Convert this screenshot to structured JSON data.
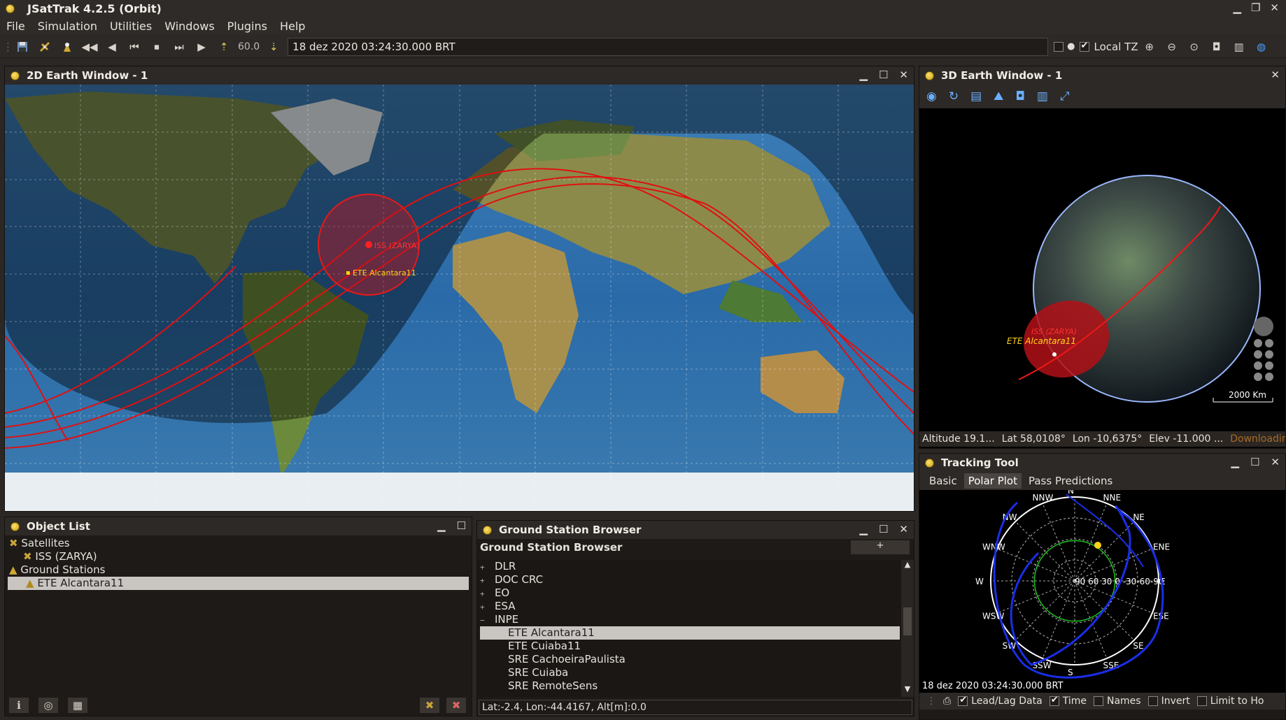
{
  "app": {
    "title": "JSatTrak 4.2.5 (Orbit)"
  },
  "menu": [
    "File",
    "Simulation",
    "Utilities",
    "Windows",
    "Plugins",
    "Help"
  ],
  "toolbar": {
    "step": "60.0",
    "datetime": "18 dez 2020 03:24:30.000 BRT",
    "local_tz_label": "Local TZ"
  },
  "earth2d": {
    "title": "2D Earth Window - 1",
    "sat_label": "ISS (ZARYA)",
    "gs_label": "ETE Alcantara11"
  },
  "earth3d": {
    "title": "3D Earth Window - 1",
    "sat_label": "ISS (ZARYA)",
    "gs_label": "ETE Alcantara11",
    "scale": "2000 Km",
    "status": {
      "altitude": "Altitude 19.1...",
      "lat": "Lat 58,0108°",
      "lon": "Lon -10,6375°",
      "elev": "Elev -11.000 ...",
      "download": "Downloading"
    }
  },
  "object_list": {
    "title": "Object List",
    "items": [
      {
        "label": "Satellites"
      },
      {
        "label": "ISS (ZARYA)"
      },
      {
        "label": "Ground Stations"
      },
      {
        "label": "ETE Alcantara11"
      }
    ]
  },
  "gsb": {
    "title": "Ground Station Browser",
    "heading": "Ground Station Browser",
    "add_label": "+",
    "items": [
      {
        "label": "DLR",
        "sign": "+"
      },
      {
        "label": "DOC CRC",
        "sign": "+"
      },
      {
        "label": "EO",
        "sign": "+"
      },
      {
        "label": "ESA",
        "sign": "+"
      },
      {
        "label": "INPE",
        "sign": "−"
      },
      {
        "label": "ETE Alcantara11"
      },
      {
        "label": "ETE Cuiaba11"
      },
      {
        "label": "SRE CachoeiraPaulista"
      },
      {
        "label": "SRE Cuiaba"
      },
      {
        "label": "SRE RemoteSens"
      }
    ],
    "status": "Lat:-2.4, Lon:-44.4167, Alt[m]:0.0"
  },
  "tracking": {
    "title": "Tracking Tool",
    "tabs": [
      "Basic",
      "Polar Plot",
      "Pass Predictions"
    ],
    "active_tab": "Polar Plot",
    "dirs": [
      "N",
      "NNE",
      "NE",
      "ENE",
      "E",
      "ESE",
      "SE",
      "SSE",
      "S",
      "SSW",
      "SW",
      "WSW",
      "W",
      "WNW",
      "NW",
      "NNW"
    ],
    "elev_labels": "90 60 30  0  -30-60-90",
    "timestamp": "18 dez 2020 03:24:30.000 BRT",
    "options": [
      {
        "label": "Lead/Lag Data",
        "checked": true
      },
      {
        "label": "Time",
        "checked": true
      },
      {
        "label": "Names",
        "checked": false
      },
      {
        "label": "Invert",
        "checked": false
      },
      {
        "label": "Limit to Ho",
        "checked": false
      }
    ]
  }
}
